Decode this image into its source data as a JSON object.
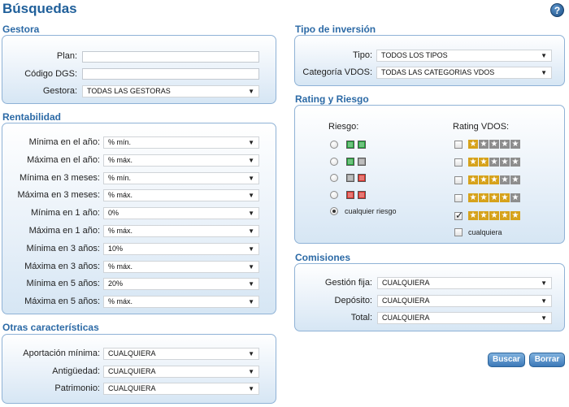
{
  "page": {
    "title": "Búsquedas",
    "help_icon": "?"
  },
  "gestora": {
    "title": "Gestora",
    "plan_label": "Plan:",
    "plan_value": "",
    "codigo_label": "Código DGS:",
    "codigo_value": "",
    "gestora_label": "Gestora:",
    "gestora_value": "TODAS LAS GESTORAS"
  },
  "rentabilidad": {
    "title": "Rentabilidad",
    "rows": [
      {
        "label": "Mínima en el año:",
        "value": "% mín."
      },
      {
        "label": "Máxima en el año:",
        "value": "% máx."
      },
      {
        "label": "Mínima en 3 meses:",
        "value": "% mín."
      },
      {
        "label": "Máxima en 3 meses:",
        "value": "% máx."
      },
      {
        "label": "Mínima en 1 año:",
        "value": "0%"
      },
      {
        "label": "Máxima en 1 año:",
        "value": "% máx."
      },
      {
        "label": "Mínima en 3 años:",
        "value": "10%"
      },
      {
        "label": "Máxima en 3 años:",
        "value": "% máx."
      },
      {
        "label": "Mínima en 5 años:",
        "value": "20%"
      },
      {
        "label": "Máxima en 5 años:",
        "value": "% máx."
      }
    ]
  },
  "otras": {
    "title": "Otras características",
    "rows": [
      {
        "label": "Aportación mínima:",
        "value": "CUALQUIERA"
      },
      {
        "label": "Antigüedad:",
        "value": "CUALQUIERA"
      },
      {
        "label": "Patrimonio:",
        "value": "CUALQUIERA"
      }
    ]
  },
  "tipo": {
    "title": "Tipo de inversión",
    "tipo_label": "Tipo:",
    "tipo_value": "TODOS LOS TIPOS",
    "categoria_label": "Categoría VDOS:",
    "categoria_value": "TODAS LAS CATEGORIAS VDOS"
  },
  "rating": {
    "title": "Rating y Riesgo",
    "riesgo_label": "Riesgo:",
    "rating_label": "Rating VDOS:",
    "risk_options": [
      {
        "colors": [
          "#22a33a",
          "#22a33a"
        ],
        "selected": false
      },
      {
        "colors": [
          "#22a33a",
          "#9a9a9a"
        ],
        "selected": false
      },
      {
        "colors": [
          "#9a9a9a",
          "#d9302a"
        ],
        "selected": false
      },
      {
        "colors": [
          "#d9302a",
          "#d9302a"
        ],
        "selected": false
      }
    ],
    "risk_any_label": "cualquier riesgo",
    "risk_any_selected": true,
    "rating_options": [
      {
        "stars": 1,
        "checked": false
      },
      {
        "stars": 2,
        "checked": false
      },
      {
        "stars": 3,
        "checked": false
      },
      {
        "stars": 4,
        "checked": false
      },
      {
        "stars": 5,
        "checked": true
      }
    ],
    "rating_any_label": "cualquiera",
    "rating_any_checked": false
  },
  "comisiones": {
    "title": "Comisiones",
    "rows": [
      {
        "label": "Gestión fija:",
        "value": "CUALQUIERA"
      },
      {
        "label": "Depósito:",
        "value": "CUALQUIERA"
      },
      {
        "label": "Total:",
        "value": "CUALQUIERA"
      }
    ]
  },
  "buttons": {
    "buscar": "Buscar",
    "borrar": "Borrar"
  },
  "colors": {
    "accent": "#2c6aa6",
    "title": "#1f5f9a",
    "panel_border": "#8fb2d6",
    "star_on": "#d6a21b",
    "star_off": "#8d8d8d"
  }
}
